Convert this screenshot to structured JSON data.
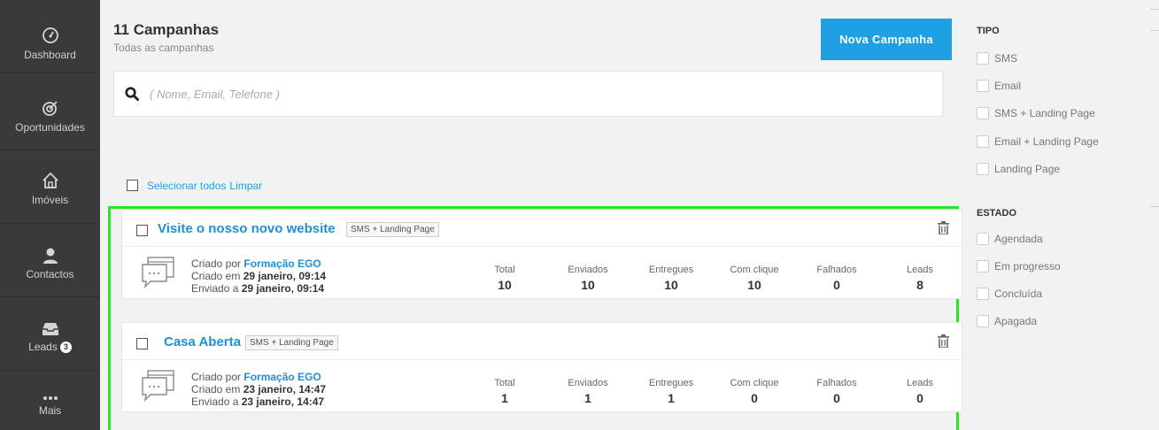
{
  "sidebar": {
    "items": [
      {
        "label": "Dashboard",
        "icon": "speedometer-icon"
      },
      {
        "label": "Oportunidades",
        "icon": "target-icon"
      },
      {
        "label": "Imóveis",
        "icon": "house-icon"
      },
      {
        "label": "Contactos",
        "icon": "user-icon"
      },
      {
        "label": "Leads",
        "icon": "inbox-icon",
        "badge": "3"
      },
      {
        "label": "Mais",
        "icon": "more-dots-icon"
      }
    ]
  },
  "header": {
    "title": "11 Campanhas",
    "subtitle": "Todas as campanhas",
    "new_button": "Nova Campanha"
  },
  "search": {
    "placeholder": "( Nome, Email, Telefone )"
  },
  "selection": {
    "select_all": "Selecionar todos",
    "clear": "Limpar"
  },
  "campaigns": [
    {
      "title": "Visite o nosso novo website",
      "type": "SMS + Landing Page",
      "created_by_prefix": "Criado por ",
      "author": "Formação EGO",
      "created_prefix": "Criado em ",
      "created_at": "29 janeiro, 09:14",
      "sent_prefix": "Enviado a ",
      "sent_at": "29 janeiro, 09:14",
      "stats": [
        {
          "label": "Total",
          "value": "10"
        },
        {
          "label": "Enviados",
          "value": "10"
        },
        {
          "label": "Entregues",
          "value": "10"
        },
        {
          "label": "Com clique",
          "value": "10"
        },
        {
          "label": "Falhados",
          "value": "0"
        },
        {
          "label": "Leads",
          "value": "8"
        }
      ]
    },
    {
      "title": "Casa Aberta",
      "type": "SMS + Landing Page",
      "created_by_prefix": "Criado por ",
      "author": "Formação EGO",
      "created_prefix": "Criado em ",
      "created_at": "23 janeiro, 14:47",
      "sent_prefix": "Enviado a ",
      "sent_at": "23 janeiro, 14:47",
      "stats": [
        {
          "label": "Total",
          "value": "1"
        },
        {
          "label": "Enviados",
          "value": "1"
        },
        {
          "label": "Entregues",
          "value": "1"
        },
        {
          "label": "Com clique",
          "value": "0"
        },
        {
          "label": "Falhados",
          "value": "0"
        },
        {
          "label": "Leads",
          "value": "0"
        }
      ]
    }
  ],
  "filters": {
    "tipo": {
      "title": "TIPO",
      "options": [
        "SMS",
        "Email",
        "SMS + Landing Page",
        "Email + Landing Page",
        "Landing Page"
      ]
    },
    "estado": {
      "title": "ESTADO",
      "options": [
        "Agendada",
        "Em progresso",
        "Concluída",
        "Apagada"
      ]
    }
  },
  "colors": {
    "accent": "#1fa0e4",
    "sidebar": "#3a3a3a",
    "highlight_frame": "#22e822"
  }
}
